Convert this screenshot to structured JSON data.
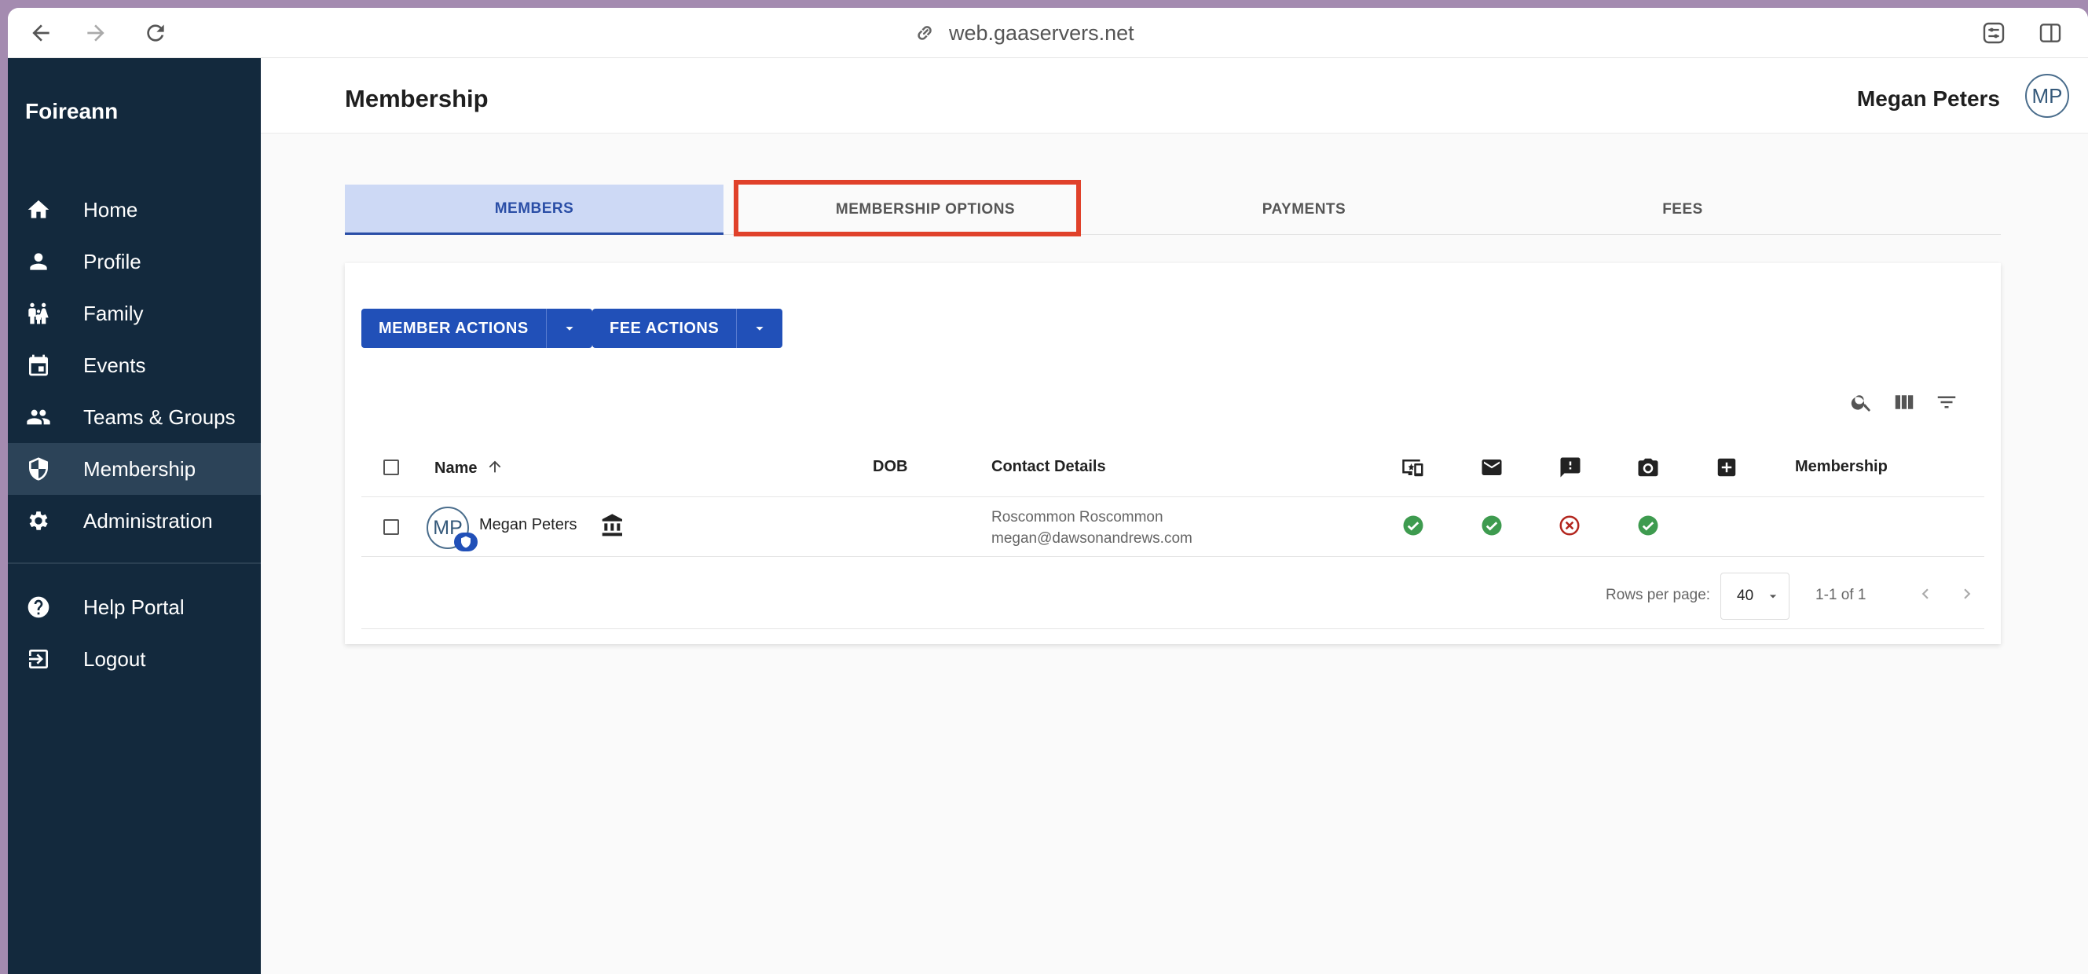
{
  "browser": {
    "url": "web.gaaservers.net"
  },
  "sidebar": {
    "brand": "Foireann",
    "items": [
      {
        "label": "Home",
        "icon": "home-icon"
      },
      {
        "label": "Profile",
        "icon": "person-icon"
      },
      {
        "label": "Family",
        "icon": "family-icon"
      },
      {
        "label": "Events",
        "icon": "calendar-icon"
      },
      {
        "label": "Teams & Groups",
        "icon": "group-icon"
      },
      {
        "label": "Membership",
        "icon": "shield-icon",
        "active": true
      },
      {
        "label": "Administration",
        "icon": "gear-icon"
      }
    ],
    "bottom_items": [
      {
        "label": "Help Portal",
        "icon": "help-icon"
      },
      {
        "label": "Logout",
        "icon": "logout-icon"
      }
    ]
  },
  "header": {
    "title": "Membership",
    "user_name": "Megan Peters",
    "user_initials": "MP"
  },
  "tabs": [
    {
      "label": "MEMBERS",
      "active": true
    },
    {
      "label": "MEMBERSHIP OPTIONS",
      "highlighted": true
    },
    {
      "label": "PAYMENTS"
    },
    {
      "label": "FEES"
    }
  ],
  "actions": {
    "member_actions": "MEMBER ACTIONS",
    "fee_actions": "FEE ACTIONS"
  },
  "table": {
    "columns": {
      "name": "Name",
      "dob": "DOB",
      "contact": "Contact Details",
      "membership": "Membership"
    },
    "icon_columns": [
      "devices-icon",
      "email-icon",
      "alert-icon",
      "camera-icon",
      "medical-icon"
    ],
    "rows": [
      {
        "initials": "MP",
        "name": "Megan Peters",
        "dob": "",
        "contact_line1": "Roscommon Roscommon",
        "contact_line2": "megan@dawsonandrews.com",
        "statuses": [
          "ok",
          "ok",
          "error",
          "ok",
          ""
        ],
        "membership": ""
      }
    ]
  },
  "pagination": {
    "rows_per_page_label": "Rows per page:",
    "rows_per_page": "40",
    "range": "1-1 of 1"
  },
  "colors": {
    "sidebar_bg": "#13293d",
    "primary": "#2150b8",
    "highlight_border": "#e0412a",
    "ok": "#3e9b4f",
    "error": "#b3261e"
  }
}
